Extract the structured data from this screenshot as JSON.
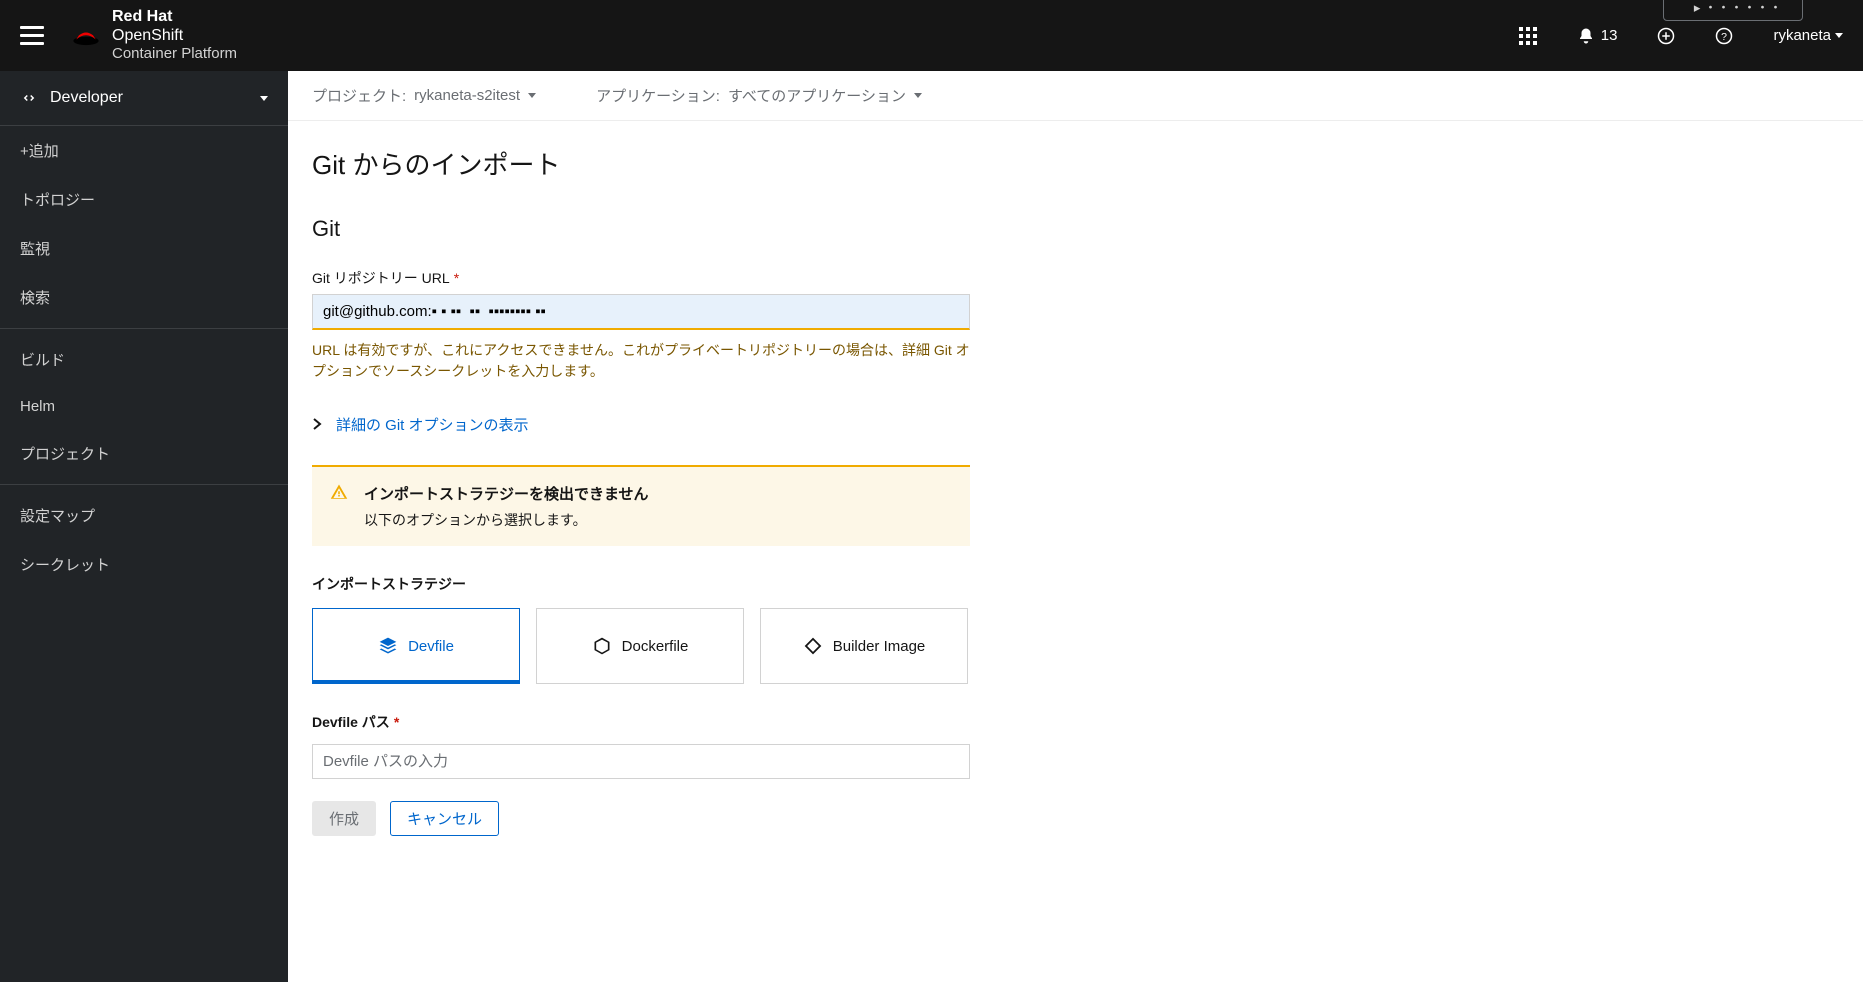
{
  "brand": {
    "line1_bold": "Red Hat",
    "line1_rest": "OpenShift",
    "line2": "Container Platform"
  },
  "topbar": {
    "notif_count": "13",
    "username": "rykaneta",
    "chip_fragment": "▸ ・・・・・・"
  },
  "perspective": {
    "label": "Developer"
  },
  "nav": {
    "add": "+追加",
    "topology": "トポロジー",
    "monitoring": "監視",
    "search": "検索",
    "builds": "ビルド",
    "helm": "Helm",
    "project": "プロジェクト",
    "configmaps": "設定マップ",
    "secrets": "シークレット"
  },
  "context": {
    "project_label": "プロジェクト:",
    "project_value": "rykaneta-s2itest",
    "app_label": "アプリケーション:",
    "app_value": "すべてのアプリケーション"
  },
  "page": {
    "title": "Git からのインポート"
  },
  "git": {
    "section": "Git",
    "url_label": "Git リポジトリー URL",
    "url_value": "git@github.com:▪ ▪ ▪▪  ▪▪  ▪▪▪▪▪▪▪▪ ▪▪",
    "url_warning": "URL は有効ですが、これにアクセスできません。これがプライベートリポジトリーの場合は、詳細 Git オプションでソースシークレットを入力します。",
    "advanced_link": "詳細の Git オプションの表示"
  },
  "alert": {
    "title": "インポートストラテジーを検出できません",
    "body": "以下のオプションから選択します。"
  },
  "strategy": {
    "label": "インポートストラテジー",
    "devfile": "Devfile",
    "dockerfile": "Dockerfile",
    "builder": "Builder Image"
  },
  "devfile_path": {
    "label": "Devfile パス",
    "placeholder": "Devfile パスの入力"
  },
  "buttons": {
    "create": "作成",
    "cancel": "キャンセル"
  }
}
